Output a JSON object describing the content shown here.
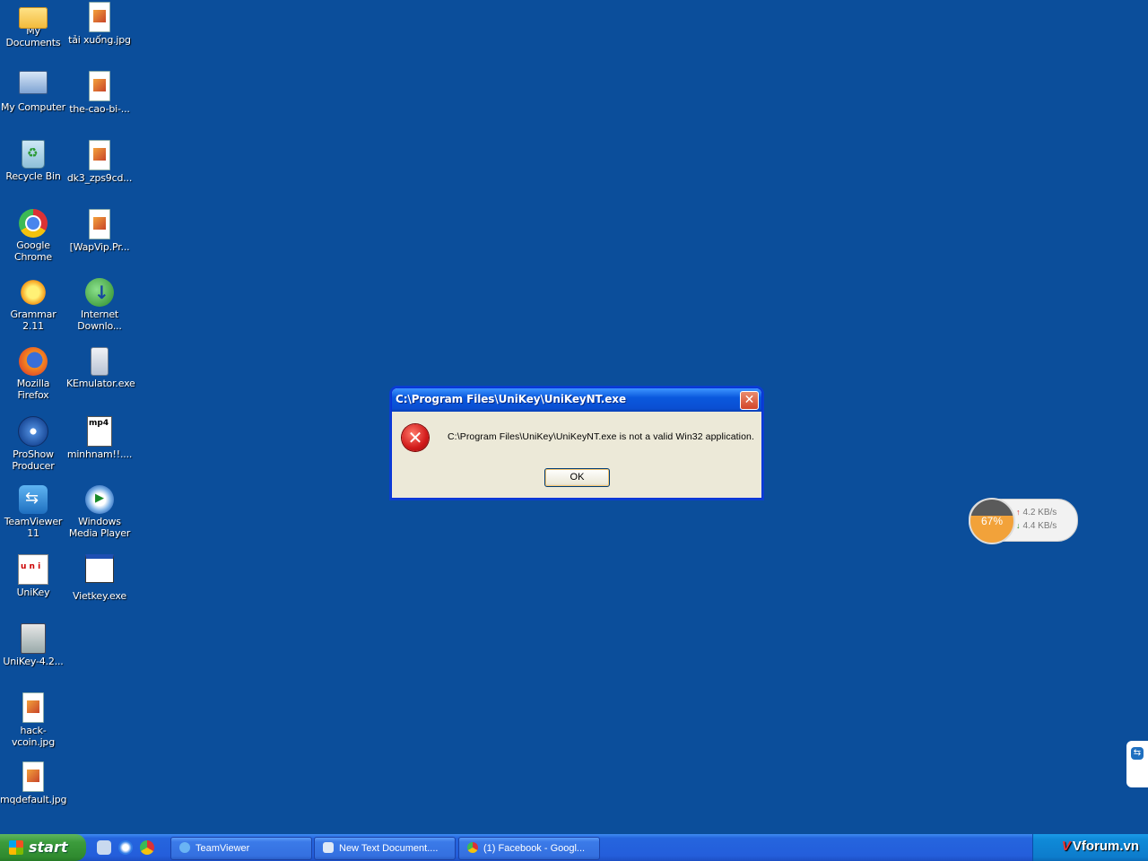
{
  "desktop": {
    "icons": [
      {
        "label": "My Documents"
      },
      {
        "label": "tải xuống.jpg"
      },
      {
        "label": "My Computer"
      },
      {
        "label": "the-cao-bi-..."
      },
      {
        "label": "Recycle Bin"
      },
      {
        "label": "dk3_zps9cd..."
      },
      {
        "label": "Google\nChrome"
      },
      {
        "label": "[WapVip.Pr..."
      },
      {
        "label": "Grammar 2.11"
      },
      {
        "label": "Internet\nDownlo..."
      },
      {
        "label": "Mozilla Firefox"
      },
      {
        "label": "KEmulator.exe"
      },
      {
        "label": "ProShow\nProducer"
      },
      {
        "label": "minhnam!!...."
      },
      {
        "label": "TeamViewer\n11"
      },
      {
        "label": "Windows\nMedia Player"
      },
      {
        "label": "UniKey"
      },
      {
        "label": "Vietkey.exe"
      },
      {
        "label": "UniKey-4.2..."
      },
      {
        "label": "hack-vcoin.jpg"
      },
      {
        "label": "mqdefault.jpg"
      }
    ]
  },
  "dialog": {
    "title": "C:\\Program Files\\UniKey\\UniKeyNT.exe",
    "close_symbol": "✕",
    "error_symbol": "✕",
    "message": "C:\\Program Files\\UniKey\\UniKeyNT.exe is not a valid Win32 application.",
    "ok_label": "OK"
  },
  "net_widget": {
    "cpu_percent": "67%",
    "upload": "4.2 KB/s",
    "download": "4.4 KB/s",
    "up_arrow": "↑",
    "down_arrow": "↓"
  },
  "taskbar": {
    "start_label": "start",
    "tasks": [
      {
        "label": "TeamViewer"
      },
      {
        "label": "New Text Document...."
      },
      {
        "label": "(1) Facebook - Googl..."
      }
    ],
    "watermark": "Vforum.vn",
    "watermark_v": "V"
  },
  "side_tab_symbol": "⇆"
}
